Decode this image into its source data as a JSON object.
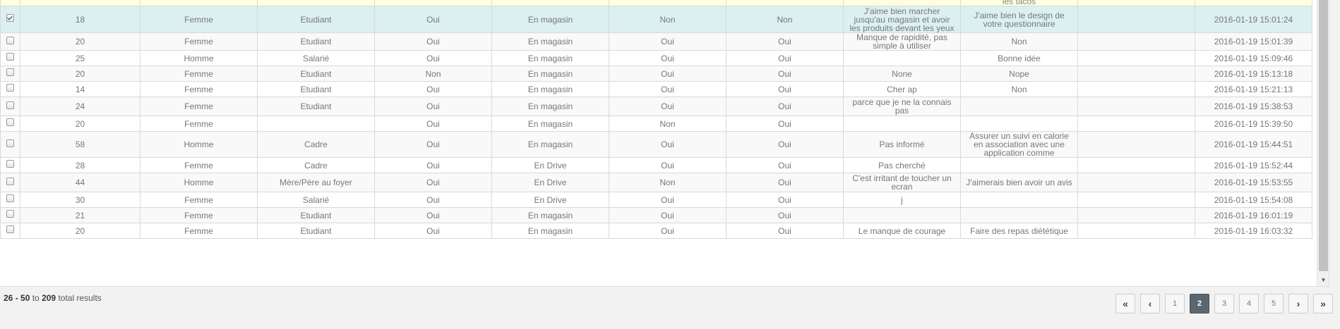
{
  "header_fragment": "les tacos",
  "rows": [
    {
      "selected": true,
      "age": "18",
      "sexe": "Femme",
      "statut": "Etudiant",
      "c4": "Oui",
      "lieu": "En magasin",
      "c6": "Non",
      "c7": "Non",
      "reason": "J'aime bien marcher jusqu'au magasin et avoir les produits devant les yeux",
      "comment": "J'aime bien le design de votre questionnaire",
      "extra": "",
      "date": "2016-01-19 15:01:24"
    },
    {
      "selected": false,
      "age": "20",
      "sexe": "Femme",
      "statut": "Etudiant",
      "c4": "Oui",
      "lieu": "En magasin",
      "c6": "Oui",
      "c7": "Oui",
      "reason": "Manque de rapidité, pas simple à utiliser",
      "comment": "Non",
      "extra": "",
      "date": "2016-01-19 15:01:39"
    },
    {
      "selected": false,
      "age": "25",
      "sexe": "Homme",
      "statut": "Salarié",
      "c4": "Oui",
      "lieu": "En magasin",
      "c6": "Oui",
      "c7": "Oui",
      "reason": "",
      "comment": "Bonne idée",
      "extra": "",
      "date": "2016-01-19 15:09:46"
    },
    {
      "selected": false,
      "age": "20",
      "sexe": "Femme",
      "statut": "Etudiant",
      "c4": "Non",
      "lieu": "En magasin",
      "c6": "Oui",
      "c7": "Oui",
      "reason": "None",
      "comment": "Nope",
      "extra": "",
      "date": "2016-01-19 15:13:18"
    },
    {
      "selected": false,
      "age": "14",
      "sexe": "Femme",
      "statut": "Etudiant",
      "c4": "Oui",
      "lieu": "En magasin",
      "c6": "Oui",
      "c7": "Oui",
      "reason": "Cher ap",
      "comment": "Non",
      "extra": "",
      "date": "2016-01-19 15:21:13"
    },
    {
      "selected": false,
      "age": "24",
      "sexe": "Femme",
      "statut": "Etudiant",
      "c4": "Oui",
      "lieu": "En magasin",
      "c6": "Oui",
      "c7": "Oui",
      "reason": "parce que je ne la connais pas",
      "comment": "",
      "extra": "",
      "date": "2016-01-19 15:38:53"
    },
    {
      "selected": false,
      "age": "20",
      "sexe": "Femme",
      "statut": "",
      "c4": "Oui",
      "lieu": "En magasin",
      "c6": "Non",
      "c7": "Oui",
      "reason": "",
      "comment": "",
      "extra": "",
      "date": "2016-01-19 15:39:50"
    },
    {
      "selected": false,
      "age": "58",
      "sexe": "Homme",
      "statut": "Cadre",
      "c4": "Oui",
      "lieu": "En magasin",
      "c6": "Oui",
      "c7": "Oui",
      "reason": "Pas informé",
      "comment": "Assurer un suivi en calorie en association avec une application comme",
      "extra": "",
      "date": "2016-01-19 15:44:51"
    },
    {
      "selected": false,
      "age": "28",
      "sexe": "Femme",
      "statut": "Cadre",
      "c4": "Oui",
      "lieu": "En Drive",
      "c6": "Oui",
      "c7": "Oui",
      "reason": "Pas cherché",
      "comment": "",
      "extra": "",
      "date": "2016-01-19 15:52:44"
    },
    {
      "selected": false,
      "age": "44",
      "sexe": "Homme",
      "statut": "Mère/Père au foyer",
      "c4": "Oui",
      "lieu": "En Drive",
      "c6": "Non",
      "c7": "Oui",
      "reason": "C'est irritant de toucher un ecran",
      "comment": "J'aimerais bien avoir un avis",
      "extra": "",
      "date": "2016-01-19 15:53:55"
    },
    {
      "selected": false,
      "age": "30",
      "sexe": "Femme",
      "statut": "Salarié",
      "c4": "Oui",
      "lieu": "En Drive",
      "c6": "Oui",
      "c7": "Oui",
      "reason": "j",
      "comment": "",
      "extra": "",
      "date": "2016-01-19 15:54:08"
    },
    {
      "selected": false,
      "age": "21",
      "sexe": "Femme",
      "statut": "Etudiant",
      "c4": "Oui",
      "lieu": "En magasin",
      "c6": "Oui",
      "c7": "Oui",
      "reason": "",
      "comment": "",
      "extra": "",
      "date": "2016-01-19 16:01:19"
    },
    {
      "selected": false,
      "age": "20",
      "sexe": "Femme",
      "statut": "Etudiant",
      "c4": "Oui",
      "lieu": "En magasin",
      "c6": "Oui",
      "c7": "Oui",
      "reason": "Le manque de courage",
      "comment": "Faire des repas diététique",
      "extra": "",
      "date": "2016-01-19 16:03:32"
    }
  ],
  "summary": {
    "from": "26",
    "dash": " - ",
    "to_value": "50",
    "to_word": " to ",
    "total": "209",
    "suffix": " total results"
  },
  "pager": {
    "first": "«",
    "prev": "‹",
    "next": "›",
    "last": "»",
    "pages": [
      "1",
      "2",
      "3",
      "4",
      "5"
    ],
    "active_page": "2"
  }
}
